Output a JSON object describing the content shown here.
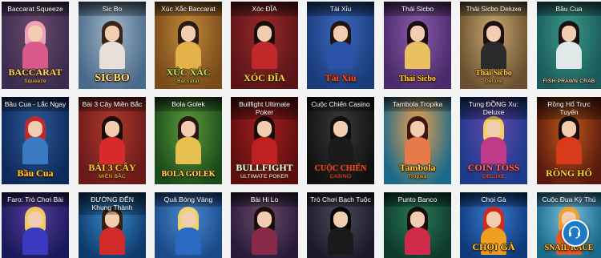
{
  "games": [
    {
      "id": "baccarat-squeeze",
      "title": "Baccarat Squeeze",
      "logo": "BACCARAT",
      "logo_sub": "Squeeze",
      "bg": [
        "#3a2c50",
        "#6b4a6a"
      ],
      "hair": "#f2a0b8",
      "outfit": "#d95a8a",
      "logo_color": "#f7d37a"
    },
    {
      "id": "sic-bo",
      "title": "Sic Bo",
      "logo": "SICBO",
      "logo_sub": "",
      "bg": [
        "#4a6a8a",
        "#a0b8c8"
      ],
      "hair": "#3a2418",
      "outfit": "#e8e0d8",
      "logo_color": "#ffe08a"
    },
    {
      "id": "xuc-xac-baccarat",
      "title": "Xúc Xắc Baccarat",
      "logo": "XÚC XẮC",
      "logo_sub": "Baccarat",
      "bg": [
        "#7a4a1a",
        "#c08a3a"
      ],
      "hair": "#2a1a12",
      "outfit": "#e2b14a",
      "logo_color": "#b8f060"
    },
    {
      "id": "xoc-dia",
      "title": "Xóc ĐĨA",
      "logo": "XÓC ĐĨA",
      "logo_sub": "",
      "bg": [
        "#5a1418",
        "#9a2a28"
      ],
      "hair": "#1a0e0a",
      "outfit": "#c0282a",
      "logo_color": "#ffd24a"
    },
    {
      "id": "tai-xiu",
      "title": "Tài Xỉu",
      "logo": "Tài Xỉu",
      "logo_sub": "",
      "bg": [
        "#1a3a7a",
        "#3a6ac0"
      ],
      "hair": "#241410",
      "outfit": "#2a52a8",
      "logo_color": "#ff4a3a"
    },
    {
      "id": "thai-sicbo",
      "title": "Thái Sicbo",
      "logo": "Thái Sicbo",
      "logo_sub": "",
      "bg": [
        "#4a2a6a",
        "#8a5aa8"
      ],
      "hair": "#1a0e12",
      "outfit": "#e8c060",
      "logo_color": "#ffcf40"
    },
    {
      "id": "thai-sicbo-deluxe",
      "title": "Thái Sicbo Deluxe",
      "logo": "Thái Sicbo",
      "logo_sub": "Deluxe",
      "bg": [
        "#6a5030",
        "#c8a870"
      ],
      "hair": "#1a1010",
      "outfit": "#2a2a2a",
      "logo_color": "#ffd24a"
    },
    {
      "id": "bau-cua",
      "title": "Bầu Cua",
      "logo": "",
      "logo_sub": "FISH PRAWN CRAB",
      "bg": [
        "#1a5a5a",
        "#3a9a8a"
      ],
      "hair": "#1a1010",
      "outfit": "#e0e8e8",
      "logo_color": "#ffffff"
    },
    {
      "id": "bau-cua-lac-ngay",
      "title": "Bầu Cua - Lắc Ngay",
      "logo": "Bầu Cua",
      "logo_sub": "",
      "bg": [
        "#0e2a5a",
        "#2a5a9a"
      ],
      "hair": "#c0282a",
      "outfit": "#3a7ac0",
      "logo_color": "#ffcf40"
    },
    {
      "id": "bai-3-cay-mien-bac",
      "title": "Bài 3 Cây Miền Bắc",
      "logo": "BÀI 3 CÂY",
      "logo_sub": "MIỀN BẮC",
      "bg": [
        "#6a1a1a",
        "#b03a2a"
      ],
      "hair": "#1a0e0a",
      "outfit": "#d82a2a",
      "logo_color": "#ffcf40"
    },
    {
      "id": "bola-golek",
      "title": "Bola Golek",
      "logo": "BOLA GOLEK",
      "logo_sub": "",
      "bg": [
        "#1a4a1a",
        "#5a9a3a"
      ],
      "hair": "#2a1810",
      "outfit": "#e8c050",
      "logo_color": "#ffe05a"
    },
    {
      "id": "bullfight-ultimate-poker",
      "title": "Bullfight Ultimate Poker",
      "logo": "BULLFIGHT",
      "logo_sub": "ULTIMATE POKER",
      "bg": [
        "#5a0e0e",
        "#a82020"
      ],
      "hair": "#1a0e0a",
      "outfit": "#c02020",
      "logo_color": "#ffffff"
    },
    {
      "id": "cuoc-chien-casino",
      "title": "Cuộc Chiến Casino",
      "logo": "CUỘC CHIẾN",
      "logo_sub": "CASINO",
      "bg": [
        "#101010",
        "#3a3a3a"
      ],
      "hair": "#101010",
      "outfit": "#1a1a1a",
      "logo_color": "#e84a3a"
    },
    {
      "id": "tambola-tropika",
      "title": "Tambola Tropika",
      "logo": "Tambola",
      "logo_sub": "Tropika",
      "bg": [
        "#1a6a8a",
        "#f0a050"
      ],
      "hair": "#3a1a10",
      "outfit": "#e87a4a",
      "logo_color": "#ffcf40"
    },
    {
      "id": "tung-dong-xu-deluxe",
      "title": "Tung ĐỒNG Xu: Deluxe",
      "logo": "COIN TOSS",
      "logo_sub": "DELUXE",
      "bg": [
        "#1a3a8a",
        "#6a4ab0"
      ],
      "hair": "#f0d060",
      "outfit": "#c03a8a",
      "logo_color": "#ff5aa0"
    },
    {
      "id": "rong-ho-truc-tuyen",
      "title": "Rồng Hổ Trực Tuyến",
      "logo": "RỒNG HỔ",
      "logo_sub": "",
      "bg": [
        "#5a1a0e",
        "#c05a1a"
      ],
      "hair": "#1a0e0a",
      "outfit": "#d83a1a",
      "logo_color": "#ffcf40"
    },
    {
      "id": "faro-tro-choi-bai",
      "title": "Faro: Trò Chơi Bài",
      "logo": "",
      "logo_sub": "",
      "bg": [
        "#1a1a5a",
        "#5a3aa0"
      ],
      "hair": "#f0c860",
      "outfit": "#3a3ac0",
      "logo_color": "#ffffff"
    },
    {
      "id": "duong-den-khung-thanh",
      "title": "ĐƯỜNG ĐẾN Khung Thành",
      "logo": "",
      "logo_sub": "",
      "bg": [
        "#0e3a6a",
        "#3a8ad0"
      ],
      "hair": "#3a2010",
      "outfit": "#d02a2a",
      "logo_color": "#ffffff"
    },
    {
      "id": "qua-bong-vang",
      "title": "Quả Bóng Vàng",
      "logo": "",
      "logo_sub": "",
      "bg": [
        "#1a4a8a",
        "#4a8ad0"
      ],
      "hair": "#f0d070",
      "outfit": "#2a6ac0",
      "logo_color": "#ffffff"
    },
    {
      "id": "bai-hi-lo",
      "title": "Bài Hi Lo",
      "logo": "",
      "logo_sub": "",
      "bg": [
        "#2a1a3a",
        "#6a4a6a"
      ],
      "hair": "#1a0e0a",
      "outfit": "#8a2a4a",
      "logo_color": "#ffffff"
    },
    {
      "id": "tro-choi-bach-tuoc",
      "title": "Trò Chơi Bạch Tuộc",
      "logo": "",
      "logo_sub": "",
      "bg": [
        "#1a1a2a",
        "#4a4a5a"
      ],
      "hair": "#0a0a0a",
      "outfit": "#1a1a1a",
      "logo_color": "#ffffff"
    },
    {
      "id": "punto-banco",
      "title": "Punto Banco",
      "logo": "",
      "logo_sub": "",
      "bg": [
        "#0e3a2a",
        "#2a7a5a"
      ],
      "hair": "#1a0e0a",
      "outfit": "#d02a4a",
      "logo_color": "#ffffff"
    },
    {
      "id": "choi-ga",
      "title": "Chọi Gà",
      "logo": "CHỌI GÀ",
      "logo_sub": "",
      "bg": [
        "#0e3a7a",
        "#3a7ad0"
      ],
      "hair": "#d02a1a",
      "outfit": "#f0a020",
      "logo_color": "#ffcf40"
    },
    {
      "id": "cuoc-dua-ky-thu",
      "title": "Cuộc Đua Kỳ Thú",
      "logo": "SNAIL RACE",
      "logo_sub": "",
      "bg": [
        "#1a6a8a",
        "#7ac0e0"
      ],
      "hair": "#f0a030",
      "outfit": "#e05a2a",
      "logo_color": "#ffd24a"
    }
  ],
  "chat_button": {
    "icon": "headset-icon"
  }
}
